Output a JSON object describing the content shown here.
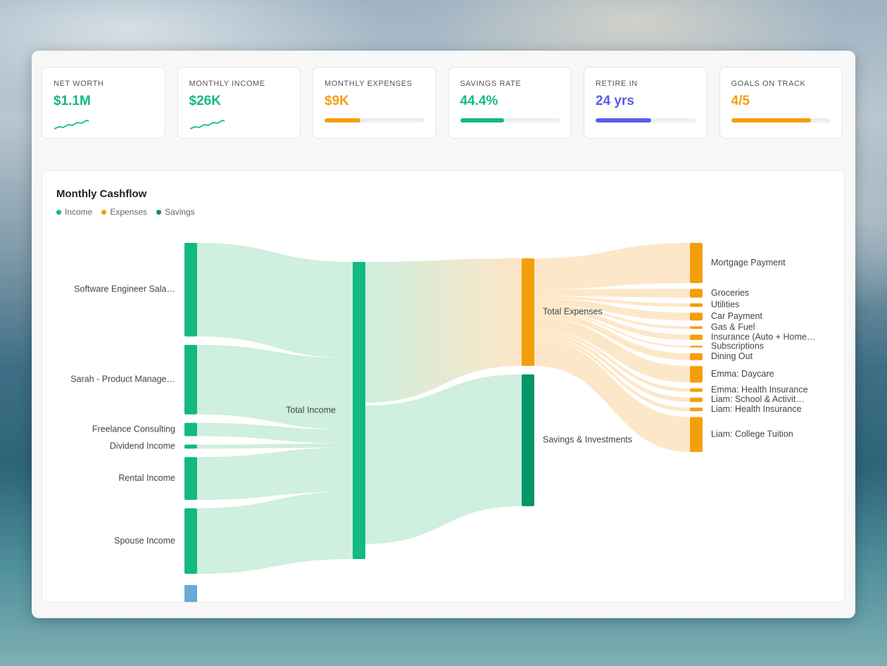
{
  "colors": {
    "income": "#12b981",
    "expenses": "#f59e0b",
    "savings": "#059669",
    "retire": "#5b5be6",
    "other_node": "#6aaad6"
  },
  "cards": [
    {
      "label": "NET WORTH",
      "value": "$1.1M",
      "color": "#12b981",
      "indicator": "sparkline"
    },
    {
      "label": "MONTHLY INCOME",
      "value": "$26K",
      "color": "#12b981",
      "indicator": "sparkline"
    },
    {
      "label": "MONTHLY EXPENSES",
      "value": "$9K",
      "color": "#f59e0b",
      "indicator": "progress",
      "progress": 0.36
    },
    {
      "label": "SAVINGS RATE",
      "value": "44.4%",
      "color": "#12b981",
      "indicator": "progress",
      "progress": 0.444
    },
    {
      "label": "RETIRE IN",
      "value": "24 yrs",
      "color": "#5b5be6",
      "indicator": "progress",
      "progress": 0.56
    },
    {
      "label": "GOALS ON TRACK",
      "value": "4/5",
      "color": "#f59e0b",
      "indicator": "progress",
      "progress": 0.8
    }
  ],
  "chart": {
    "title": "Monthly Cashflow",
    "legend": [
      {
        "label": "Income",
        "color": "#12b981"
      },
      {
        "label": "Expenses",
        "color": "#f59e0b"
      },
      {
        "label": "Savings",
        "color": "#059669"
      }
    ]
  },
  "chart_data": {
    "type": "sankey",
    "title": "Monthly Cashflow",
    "sources": [
      {
        "name": "Software Engineer Sala…",
        "value": 7
      },
      {
        "name": "Sarah - Product Manage…",
        "value": 5.2
      },
      {
        "name": "Freelance Consulting",
        "value": 1
      },
      {
        "name": "Dividend Income",
        "value": 0.3
      },
      {
        "name": "Rental Income",
        "value": 3.2
      },
      {
        "name": "Spouse Income",
        "value": 4.9
      }
    ],
    "total_income": {
      "name": "Total Income",
      "value": 21.6
    },
    "middle": [
      {
        "name": "Total Expenses",
        "value": 8
      },
      {
        "name": "Savings & Investments",
        "value": 9.8
      }
    ],
    "expenses": [
      {
        "name": "Mortgage Payment",
        "value": 2.3
      },
      {
        "name": "Groceries",
        "value": 0.5
      },
      {
        "name": "Utilities",
        "value": 0.2
      },
      {
        "name": "Car Payment",
        "value": 0.45
      },
      {
        "name": "Gas & Fuel",
        "value": 0.15
      },
      {
        "name": "Insurance (Auto + Home…",
        "value": 0.3
      },
      {
        "name": "Subscriptions",
        "value": 0.1
      },
      {
        "name": "Dining Out",
        "value": 0.4
      },
      {
        "name": "Emma: Daycare",
        "value": 0.95
      },
      {
        "name": "Emma: Health Insurance",
        "value": 0.2
      },
      {
        "name": "Liam: School & Activit…",
        "value": 0.25
      },
      {
        "name": "Liam: Health Insurance",
        "value": 0.2
      },
      {
        "name": "Liam: College Tuition",
        "value": 2
      }
    ]
  }
}
